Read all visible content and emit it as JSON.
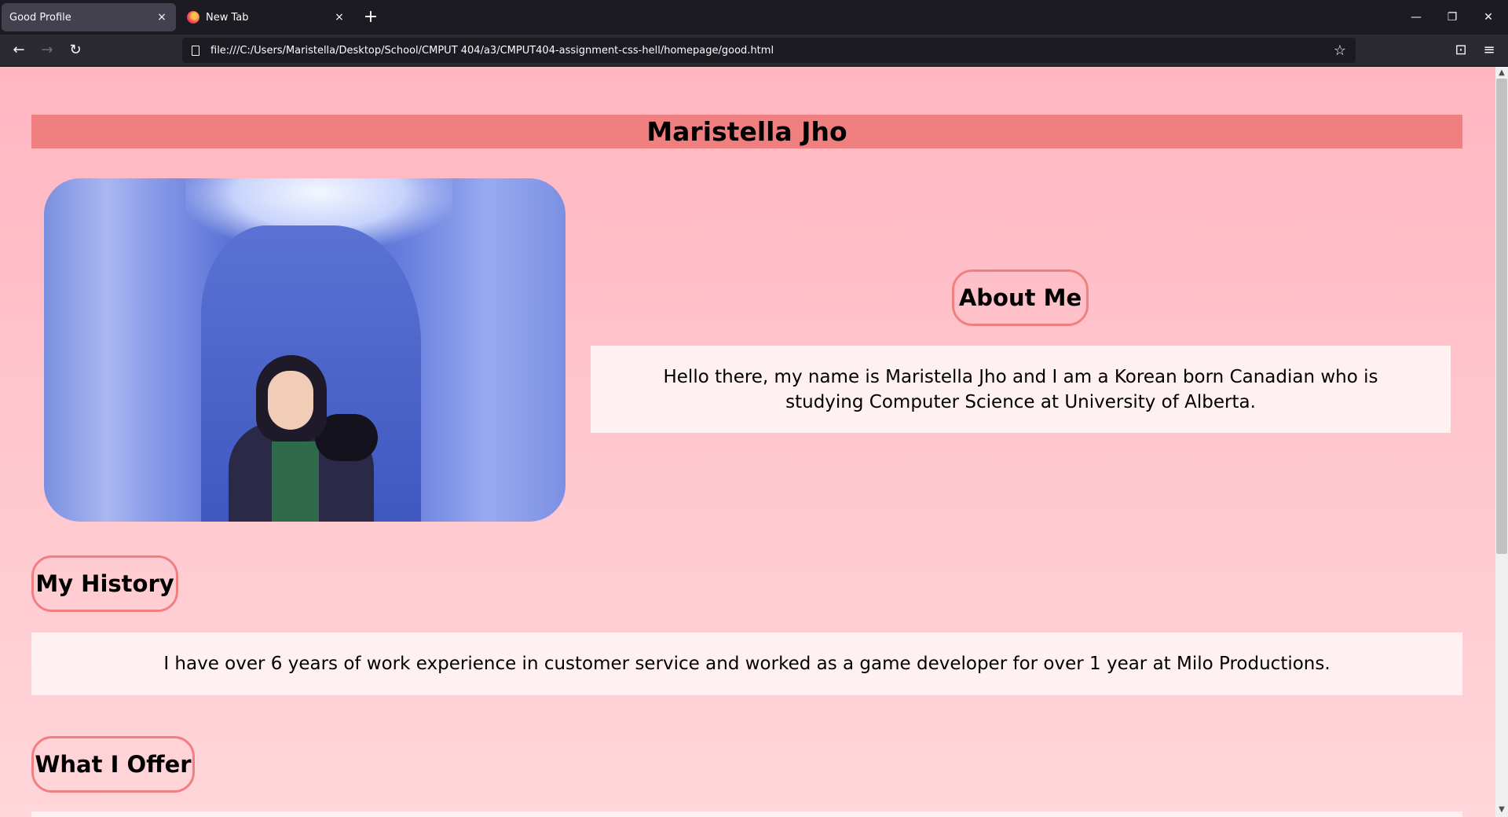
{
  "browser": {
    "tabs": [
      {
        "title": "Good Profile",
        "active": true
      },
      {
        "title": "New Tab",
        "active": false
      }
    ],
    "url": "file:///C:/Users/Maristella/Desktop/School/CMPUT 404/a3/CMPUT404-assignment-css-hell/homepage/good.html",
    "icons": {
      "back": "←",
      "forward": "→",
      "reload": "↻",
      "star": "☆",
      "pocket": "⊡",
      "menu": "≡",
      "close": "×",
      "new_tab": "+",
      "minimize": "—",
      "restore": "❐",
      "window_close": "✕"
    }
  },
  "page": {
    "title": "Maristella Jho",
    "about": {
      "heading": "About Me",
      "text": "Hello there, my name is Maristella Jho and I am a Korean born Canadian who is studying Computer Science at University of Alberta."
    },
    "history": {
      "heading": "My History",
      "text": "I have over 6 years of work experience in customer service and worked as a game developer for over 1 year at Milo Productions."
    },
    "offer": {
      "heading": "What I Offer"
    },
    "colors": {
      "accent": "#f08080",
      "background_top": "#ffb6c1",
      "background_bottom": "#ffd6da",
      "box": "#fff0f2"
    }
  }
}
